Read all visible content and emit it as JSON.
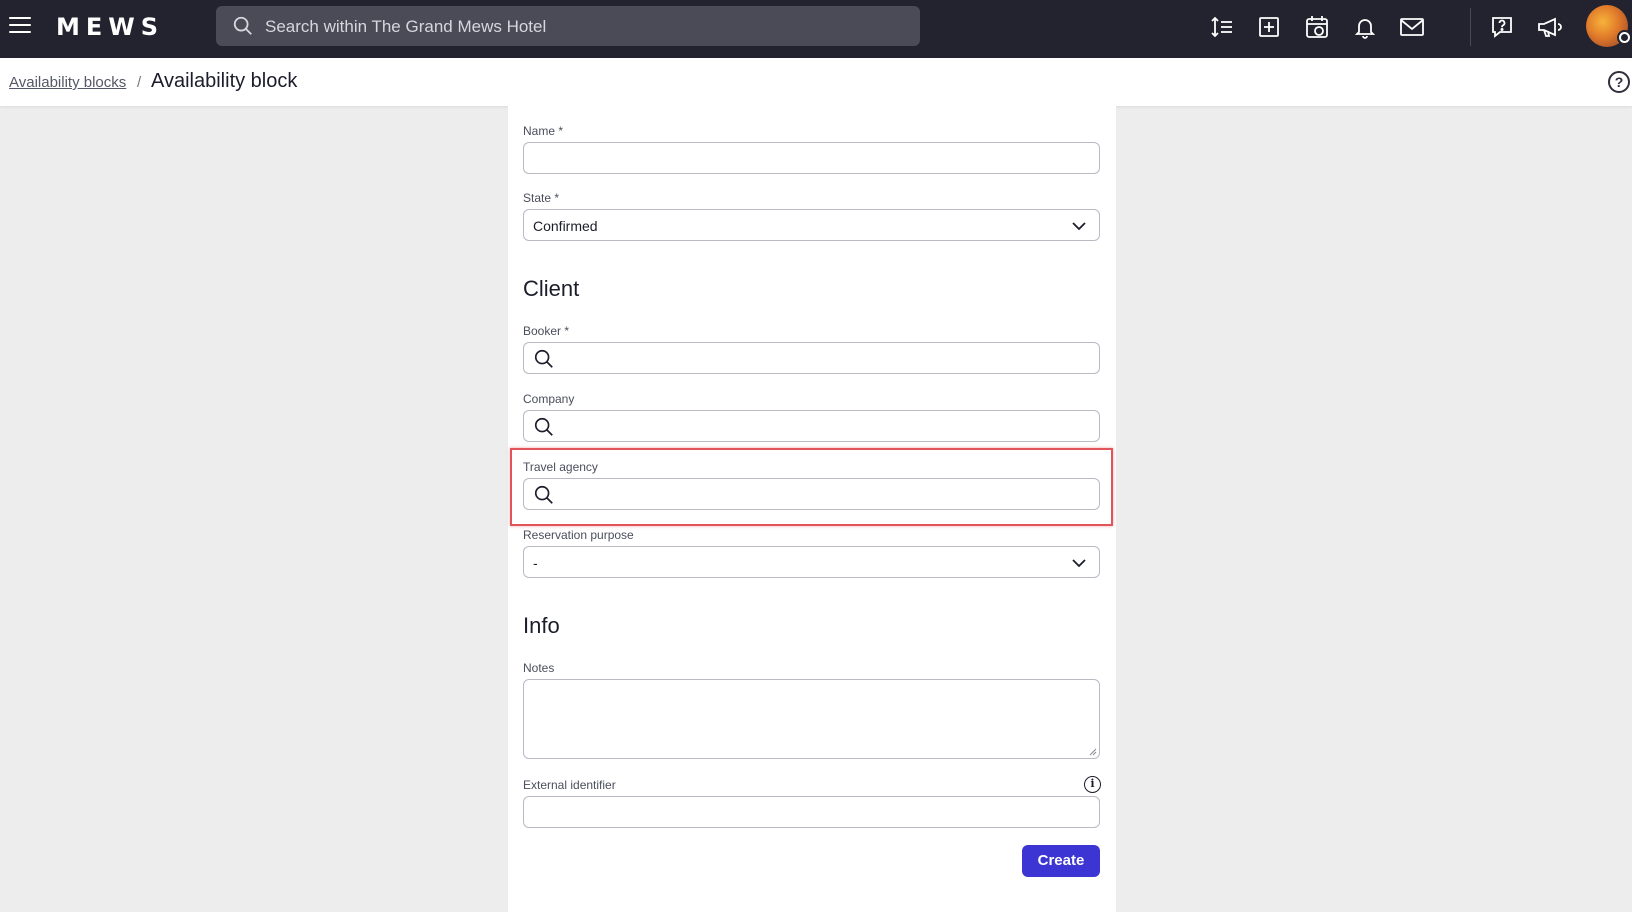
{
  "app": {
    "logo_text": "MEWS",
    "search_placeholder": "Search within The Grand Mews Hotel"
  },
  "toolbar_icons": [
    "sort-lines-icon",
    "add-square-icon",
    "calendar-refresh-icon",
    "bell-icon",
    "mail-icon",
    "help-chat-icon",
    "megaphone-icon"
  ],
  "breadcrumb": {
    "parent": "Availability blocks",
    "separator": "/",
    "current": "Availability block"
  },
  "form": {
    "name": {
      "label": "Name *",
      "value": ""
    },
    "state": {
      "label": "State *",
      "value": "Confirmed"
    },
    "client_section": "Client",
    "booker": {
      "label": "Booker *",
      "value": ""
    },
    "company": {
      "label": "Company",
      "value": ""
    },
    "travel_agency": {
      "label": "Travel agency",
      "value": ""
    },
    "reservation_purpose": {
      "label": "Reservation purpose",
      "value": "-"
    },
    "info_section": "Info",
    "notes": {
      "label": "Notes",
      "value": ""
    },
    "external_identifier": {
      "label": "External identifier",
      "value": ""
    },
    "create_label": "Create"
  },
  "colors": {
    "topbar": "#23232f",
    "primary_button": "#3c34d3",
    "highlight": "#e0545a"
  }
}
